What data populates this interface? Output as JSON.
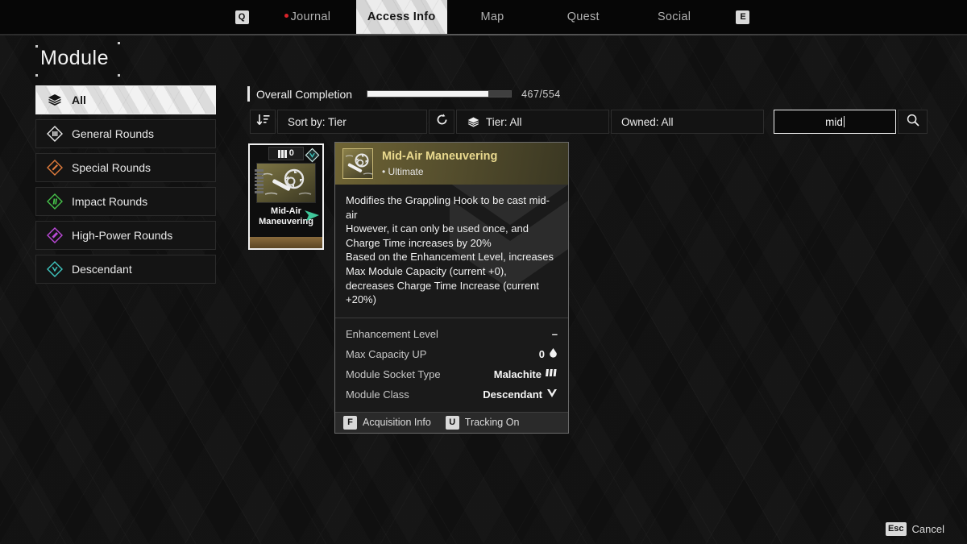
{
  "nav": {
    "left_key": "Q",
    "right_key": "E",
    "tabs": [
      {
        "label": "Journal",
        "active": false,
        "dot": true
      },
      {
        "label": "Access Info",
        "active": true,
        "dot": false
      },
      {
        "label": "Map",
        "active": false,
        "dot": false
      },
      {
        "label": "Quest",
        "active": false,
        "dot": false
      },
      {
        "label": "Social",
        "active": false,
        "dot": false
      }
    ]
  },
  "page": {
    "title": "Module"
  },
  "sidebar": {
    "items": [
      {
        "label": "All",
        "icon": "layers-icon",
        "color": "#1a1a1a",
        "active": true
      },
      {
        "label": "General Rounds",
        "icon": "general-rounds-icon",
        "color": "#e8e8e8",
        "active": false
      },
      {
        "label": "Special Rounds",
        "icon": "special-rounds-icon",
        "color": "#e07b3c",
        "active": false
      },
      {
        "label": "Impact Rounds",
        "icon": "impact-rounds-icon",
        "color": "#46c24a",
        "active": false
      },
      {
        "label": "High-Power Rounds",
        "icon": "high-power-rounds-icon",
        "color": "#bb49d8",
        "active": false
      },
      {
        "label": "Descendant",
        "icon": "descendant-icon",
        "color": "#3fc7c0",
        "active": false
      }
    ]
  },
  "completion": {
    "label": "Overall Completion",
    "current": 467,
    "total": 554,
    "count_text": "467/554",
    "percent": 84
  },
  "toolbar": {
    "sort_icon": "sort-descending-icon",
    "sort_label": "Sort by: Tier",
    "reset_icon": "reset-icon",
    "tier_icon": "layers-icon",
    "tier_label": "Tier: All",
    "owned_label": "Owned: All",
    "search_value": "mid",
    "search_placeholder": "Search",
    "search_icon": "search-icon"
  },
  "card": {
    "tier_number": "0",
    "tier_marks": 3,
    "name": "Mid-Air Maneuvering",
    "badge": "descendant-badge-icon",
    "badge_color": "#3fc7c0"
  },
  "tooltip": {
    "title": "Mid-Air Maneuvering",
    "subtitle": "• Ultimate",
    "icon": "grappling-hook-icon",
    "description": [
      "Modifies the Grappling Hook to be cast mid-air",
      "However, it can only be used once, and Charge Time increases by 20%",
      "Based on the Enhancement Level, increases Max Module Capacity (current +0), decreases Charge Time Increase (current +20%)"
    ],
    "stats": [
      {
        "key": "Enhancement Level",
        "value": "–",
        "icon": ""
      },
      {
        "key": "Max Capacity UP",
        "value": "0",
        "icon": "capacity-drop-icon"
      },
      {
        "key": "Module Socket Type",
        "value": "Malachite",
        "icon": "malachite-socket-icon"
      },
      {
        "key": "Module Class",
        "value": "Descendant",
        "icon": "descendant-class-icon"
      }
    ],
    "hints": [
      {
        "key": "F",
        "label": "Acquisition Info"
      },
      {
        "key": "U",
        "label": "Tracking On"
      }
    ]
  },
  "bottom": {
    "key": "Esc",
    "label": "Cancel"
  },
  "colors": {
    "accent_gold": "#e9d98e",
    "panel_bg": "#1a1a1a",
    "teal": "#3fc7c0",
    "alert_red": "#d8232a"
  }
}
